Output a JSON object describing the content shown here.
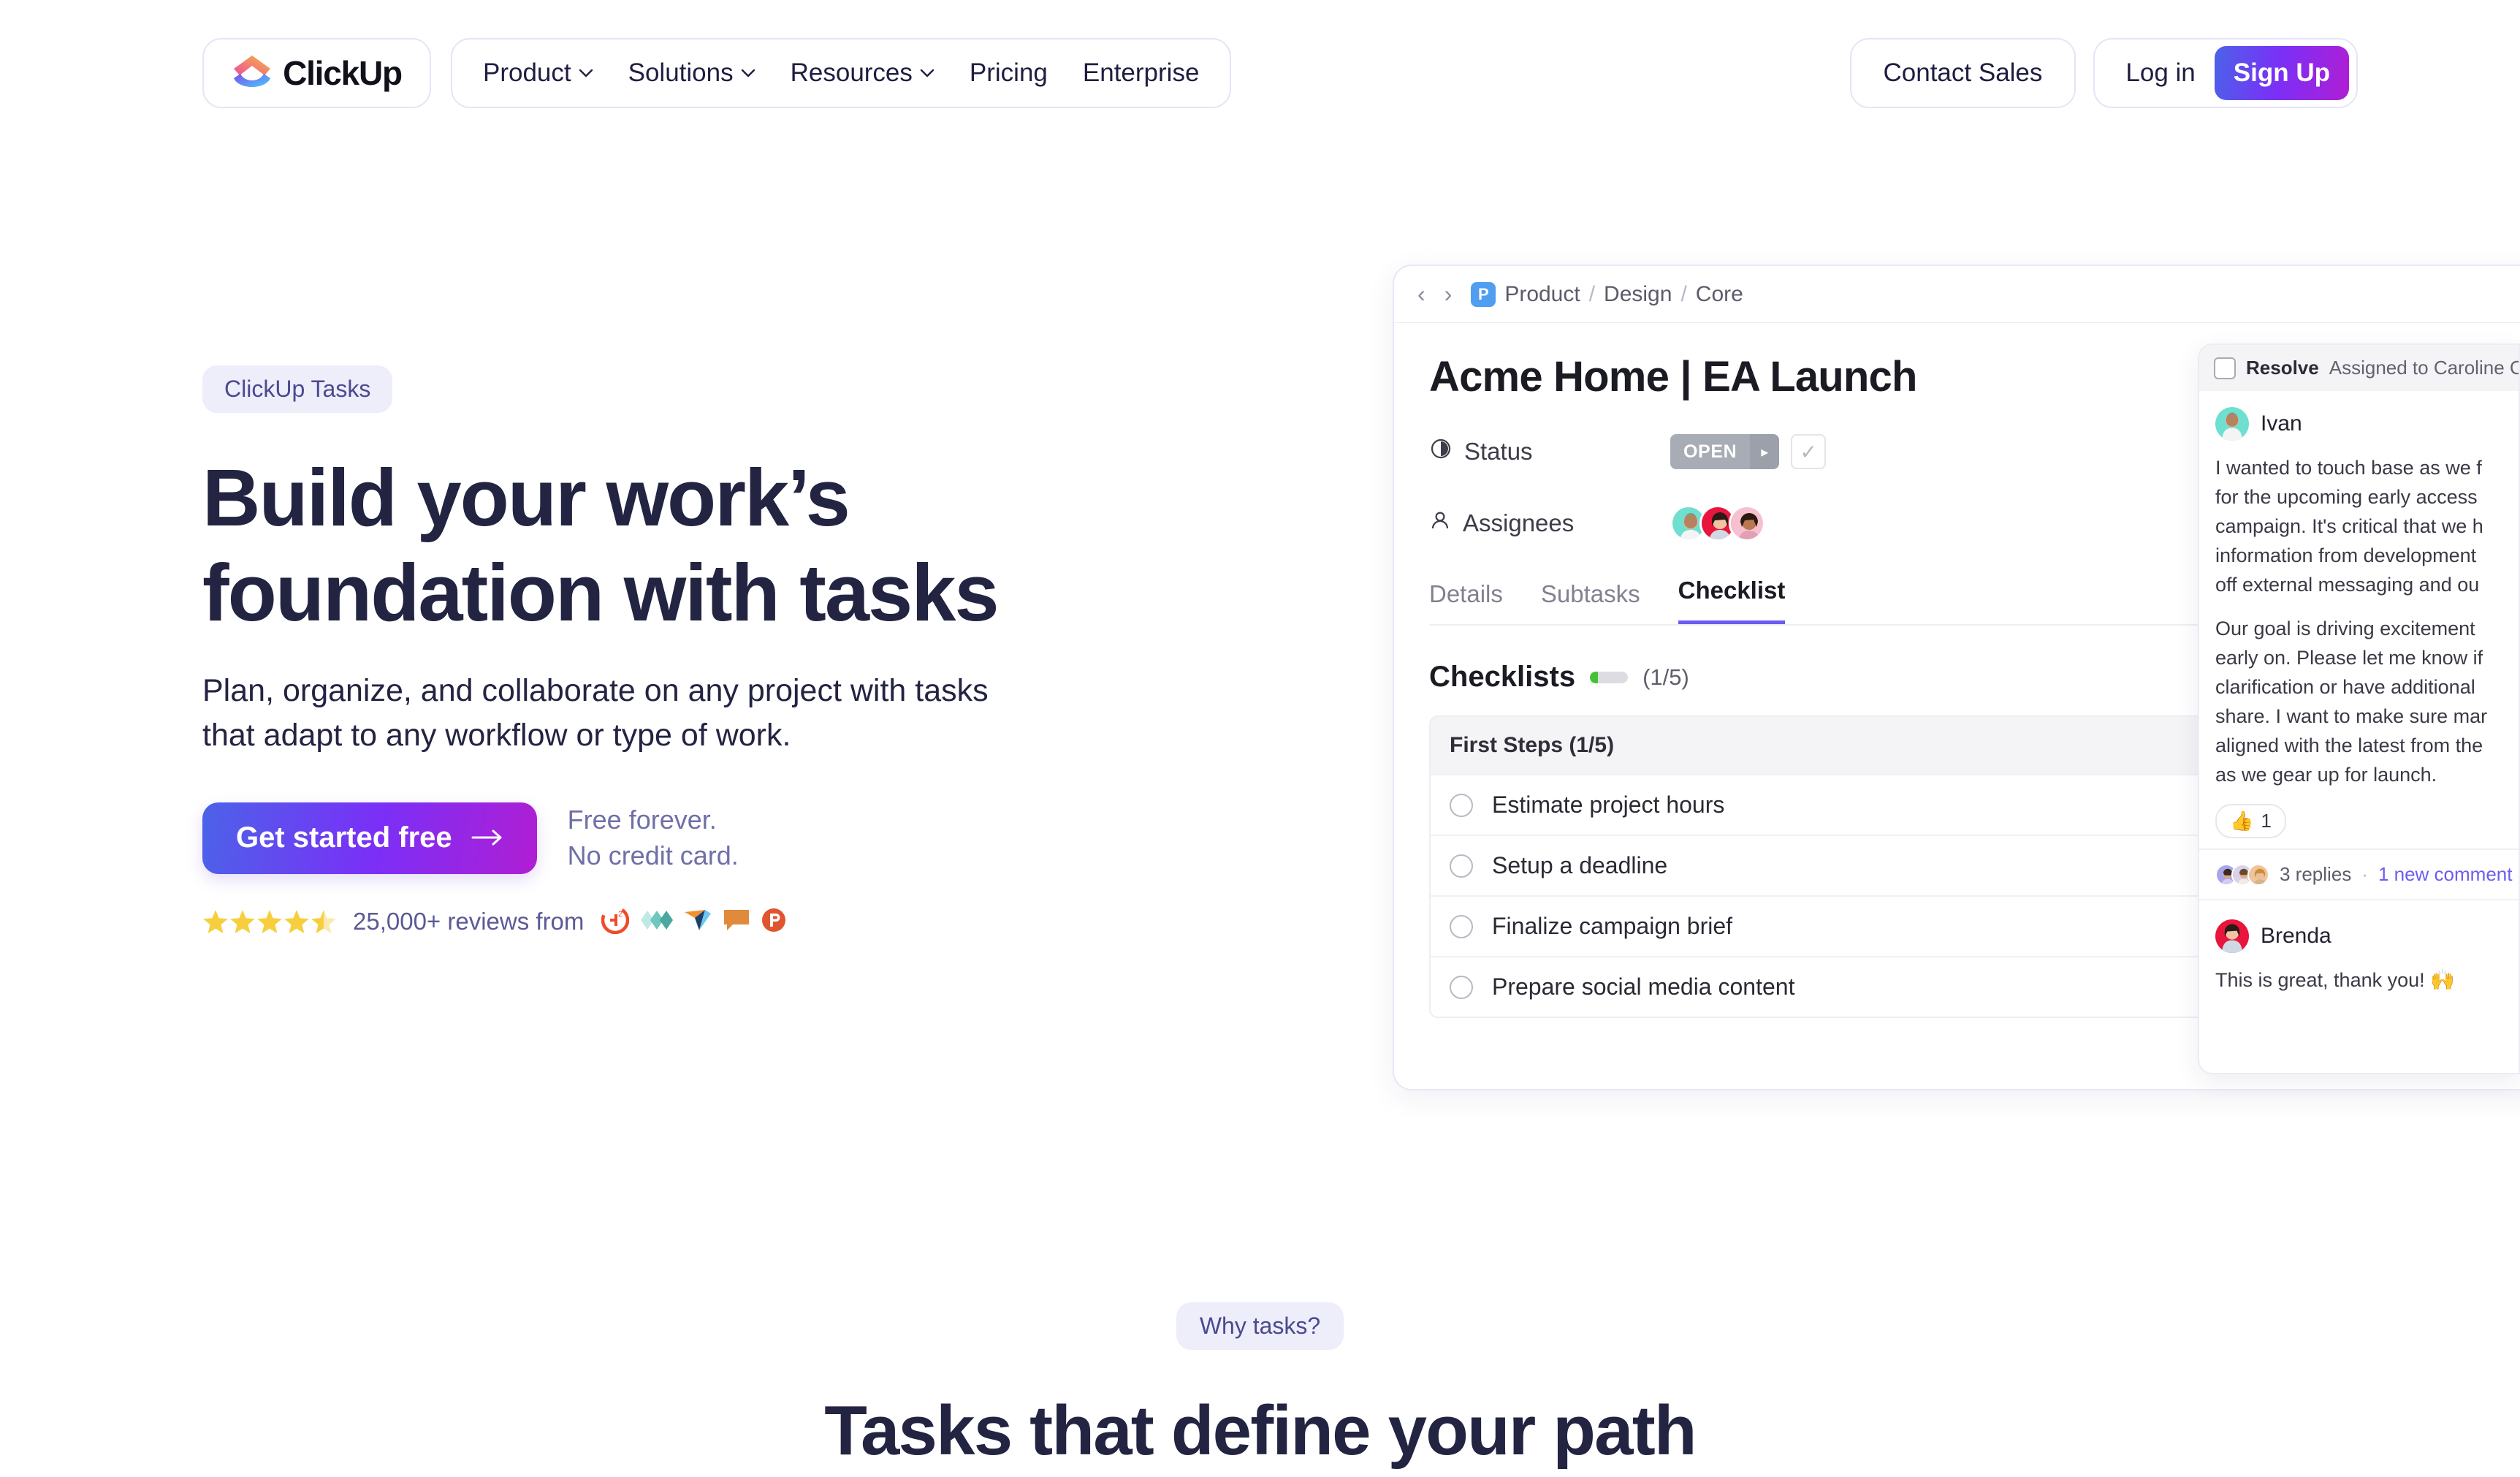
{
  "nav": {
    "brand": "ClickUp",
    "brand_logo_icon": "clickup-logo-icon",
    "items": [
      {
        "label": "Product",
        "has_dropdown": true
      },
      {
        "label": "Solutions",
        "has_dropdown": true
      },
      {
        "label": "Resources",
        "has_dropdown": true
      },
      {
        "label": "Pricing",
        "has_dropdown": false
      },
      {
        "label": "Enterprise",
        "has_dropdown": false
      }
    ],
    "contact_sales": "Contact Sales",
    "login": "Log in",
    "signup": "Sign Up"
  },
  "hero": {
    "eyebrow": "ClickUp Tasks",
    "heading_line1": "Build your work’s",
    "heading_line2": "foundation with tasks",
    "sub_line1": "Plan, organize, and collaborate on any project with tasks",
    "sub_line2": "that adapt to any workflow or type of work.",
    "cta_label": "Get started free",
    "cta_arrow_icon": "arrow-right-icon",
    "note_line1": "Free forever.",
    "note_line2": "No credit card.",
    "rating_value": 4.5,
    "rating_stars_total": 5,
    "reviews_text": "25,000+ reviews from",
    "review_brands": [
      "g2-logo-icon",
      "capterra-logo-icon",
      "getapp-logo-icon",
      "software-advice-logo-icon",
      "product-hunt-logo-icon"
    ]
  },
  "app": {
    "breadcrumb": {
      "back_icon": "chevron-left-icon",
      "forward_icon": "chevron-right-icon",
      "project_badge": "P",
      "parts": [
        "Product",
        "Design",
        "Core"
      ],
      "separator": "/"
    },
    "task_title": "Acme Home | EA Launch",
    "fields": [
      {
        "icon": "status-clock-icon",
        "label": "Status",
        "value": "OPEN"
      },
      {
        "icon": "person-icon",
        "label": "Assignees",
        "value": ""
      }
    ],
    "status_value": "OPEN",
    "status_arrow_icon": "caret-right-icon",
    "status_check_icon": "check-icon",
    "assignees": [
      "Ivan",
      "Brenda",
      "Caroline"
    ],
    "tabs": [
      {
        "label": "Details",
        "active": false
      },
      {
        "label": "Subtasks",
        "active": false
      },
      {
        "label": "Checklist",
        "active": true
      }
    ],
    "checklists": {
      "title": "Checklists",
      "count": "(1/5)",
      "progress_percent": 20,
      "add_icon": "plus-icon",
      "group_title": "First Steps (1/5)",
      "items": [
        "Estimate project hours",
        "Setup a deadline",
        "Finalize campaign brief",
        "Prepare social media content"
      ]
    }
  },
  "comments": {
    "resolve_label": "Resolve",
    "assigned_label": "Assigned to Caroline C",
    "thread": [
      {
        "author": "Ivan",
        "paragraphs": [
          "I wanted to touch base as we f",
          "for the upcoming early access",
          "campaign. It's critical that we h",
          "information from development",
          "off external messaging and ou"
        ],
        "paragraphs2": [
          "Our goal is driving excitement",
          "early on. Please let me know if",
          "clarification or have additional",
          "share. I want to make sure mar",
          "aligned with the latest from the",
          "as we gear up for launch."
        ],
        "reaction_emoji": "👍",
        "reaction_count": "1",
        "replies_text": "3 replies",
        "separator": "·",
        "new_comment_text": "1 new comment"
      },
      {
        "author": "Brenda",
        "text": "This is great, thank you! 🙌"
      }
    ]
  },
  "bottom": {
    "badge": "Why tasks?",
    "heading": "Tasks that define your path"
  },
  "colors": {
    "brand_purple": "#7b2ff7",
    "brand_blue": "#4b63e8",
    "heading_navy": "#232342",
    "eyebrow_bg": "#eeedfa",
    "eyebrow_text": "#4a4a8f",
    "star_gold": "#f6c game",
    "progress_green": "#45c234",
    "tab_active": "#6c5cf0"
  }
}
